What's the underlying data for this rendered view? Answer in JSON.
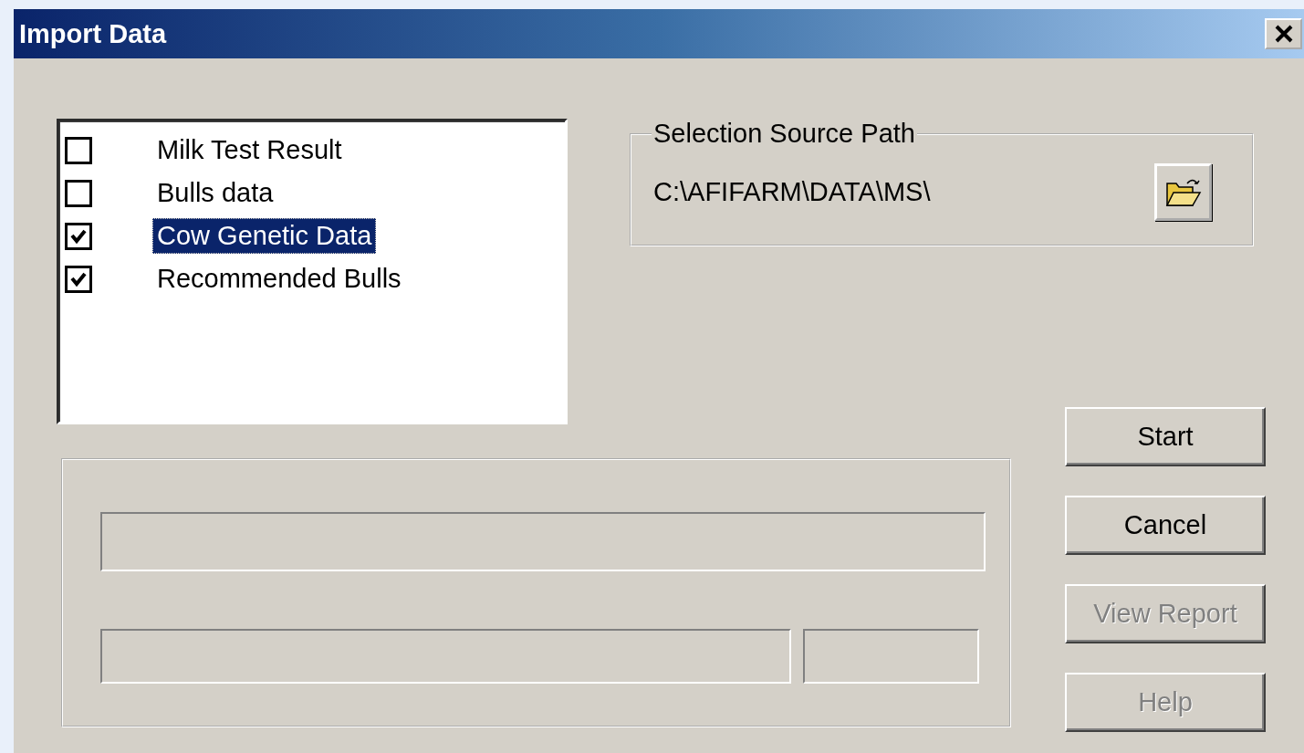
{
  "window": {
    "title": "Import Data"
  },
  "data_list": {
    "items": [
      {
        "label": "Milk Test Result",
        "checked": false,
        "selected": false
      },
      {
        "label": "Bulls data",
        "checked": false,
        "selected": false
      },
      {
        "label": "Cow Genetic Data",
        "checked": true,
        "selected": true
      },
      {
        "label": "Recommended Bulls",
        "checked": true,
        "selected": false
      }
    ]
  },
  "source_path": {
    "legend": "Selection Source Path",
    "path": "C:\\AFIFARM\\DATA\\MS\\"
  },
  "buttons": [
    {
      "label": "Start",
      "disabled": false
    },
    {
      "label": "Cancel",
      "disabled": false
    },
    {
      "label": "View Report",
      "disabled": true
    },
    {
      "label": "Help",
      "disabled": true
    }
  ]
}
